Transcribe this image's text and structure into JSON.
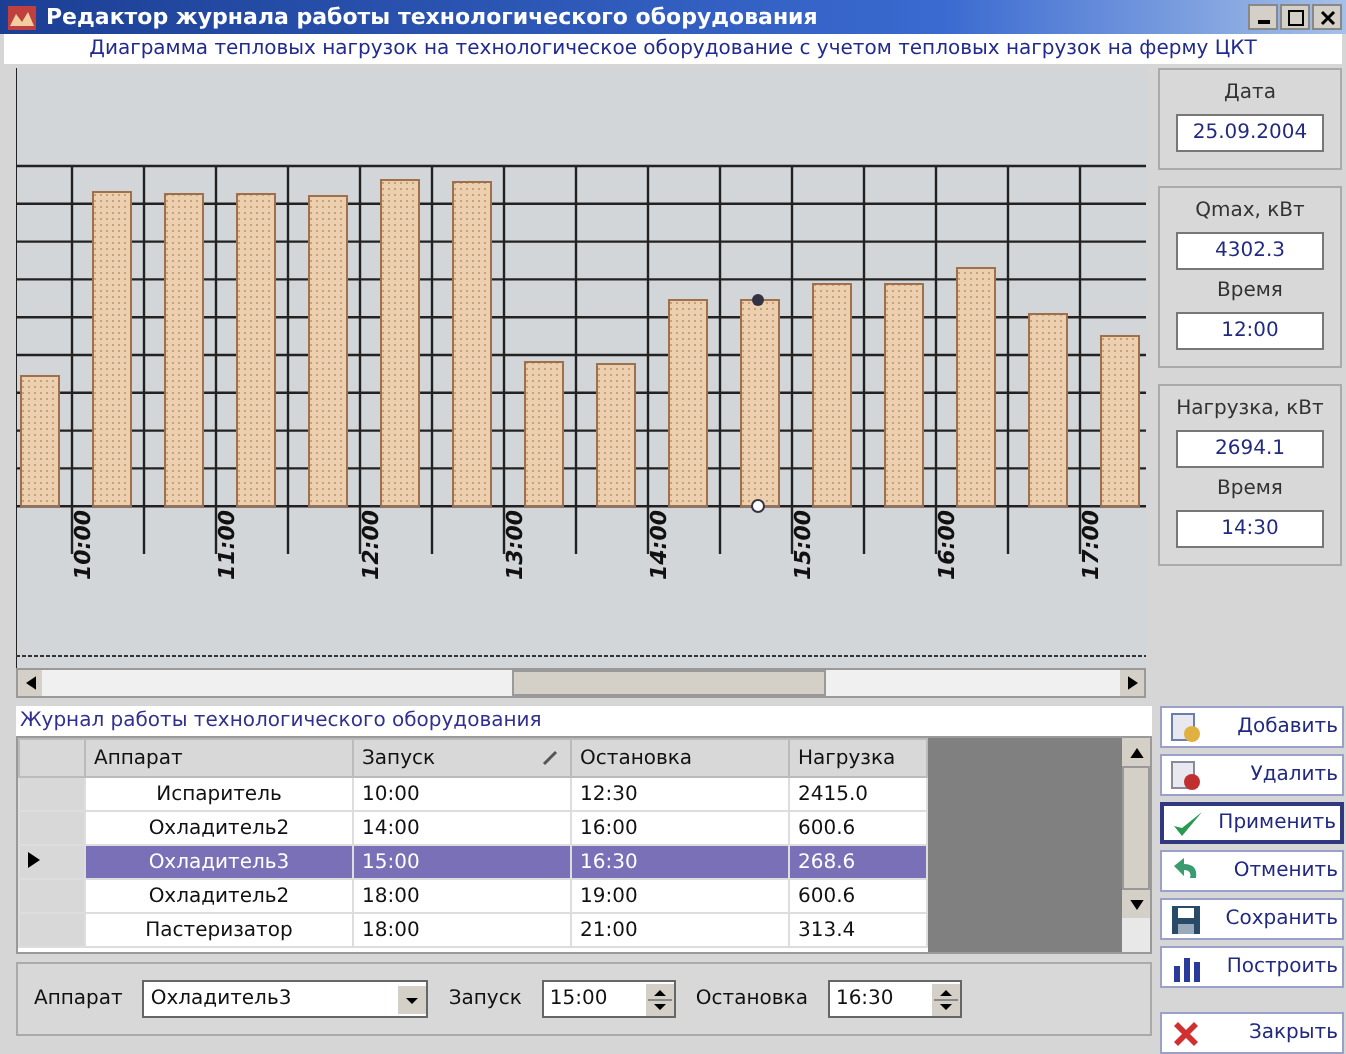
{
  "window": {
    "title": "Редактор журнала работы технологического оборудования"
  },
  "chart": {
    "subtitle": "Диаграмма тепловых нагрузок на технологическое оборудование с учетом тепловых нагрузок на ферму ЦКТ",
    "time_labels": [
      "10:00",
      "11:00",
      "12:00",
      "13:00",
      "14:00",
      "15:00",
      "16:00",
      "17:00"
    ]
  },
  "panels": [
    {
      "label": "Дата",
      "value": "25.09.2004"
    },
    {
      "label": "Qmax, кВт",
      "value": "4302.3",
      "time_label": "Время",
      "time_value": "12:00"
    },
    {
      "label": "Нагрузка, кВт",
      "value": "2694.1",
      "time_label": "Время",
      "time_value": "14:30"
    }
  ],
  "journal": {
    "caption": "Журнал работы технологического оборудования",
    "columns": [
      {
        "label": "Аппарат",
        "sorted": false
      },
      {
        "label": "Запуск",
        "sorted": true
      },
      {
        "label": "Остановка",
        "sorted": false
      },
      {
        "label": "Нагрузка",
        "sorted": false
      }
    ],
    "rows": [
      {
        "selected": false,
        "cells": [
          "Испаритель",
          "10:00",
          "12:30",
          "2415.0"
        ]
      },
      {
        "selected": false,
        "cells": [
          "Охладитель2",
          "14:00",
          "16:00",
          "600.6"
        ]
      },
      {
        "selected": true,
        "cells": [
          "Охладитель3",
          "15:00",
          "16:30",
          "268.6"
        ]
      },
      {
        "selected": false,
        "cells": [
          "Охладитель2",
          "18:00",
          "19:00",
          "600.6"
        ]
      },
      {
        "selected": false,
        "cells": [
          "Пастеризатор",
          "18:00",
          "21:00",
          "313.4"
        ]
      }
    ]
  },
  "editor": {
    "apparatus_label": "Аппарат",
    "apparatus_value": "Охладитель3",
    "start_label": "Запуск",
    "start_value": "15:00",
    "stop_label": "Остановка",
    "stop_value": "16:30"
  },
  "buttons": [
    {
      "kind": "add",
      "label": "Добавить",
      "selected": false
    },
    {
      "kind": "delete",
      "label": "Удалить",
      "selected": false
    },
    {
      "kind": "apply",
      "label": "Применить",
      "selected": true
    },
    {
      "kind": "undo",
      "label": "Отменить",
      "selected": false
    },
    {
      "kind": "save",
      "label": "Сохранить",
      "selected": false
    },
    {
      "kind": "plot",
      "label": "Построить",
      "selected": false
    }
  ],
  "close_button": {
    "kind": "close",
    "label": "Закрыть"
  }
}
